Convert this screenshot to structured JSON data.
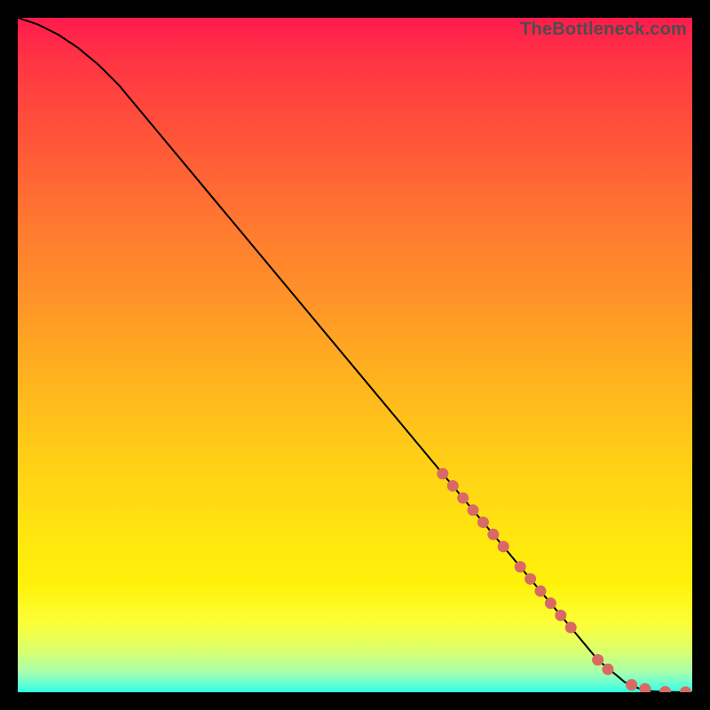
{
  "watermark": "TheBottleneck.com",
  "chart_data": {
    "type": "line",
    "title": "",
    "xlabel": "",
    "ylabel": "",
    "xlim": [
      0,
      100
    ],
    "ylim": [
      0,
      100
    ],
    "grid": false,
    "legend": false,
    "series": [
      {
        "name": "curve",
        "style": "line",
        "color": "#000000",
        "x": [
          0,
          3,
          6,
          9,
          12,
          15,
          20,
          30,
          40,
          50,
          60,
          70,
          80,
          86,
          90,
          92,
          94,
          96,
          98,
          100
        ],
        "y": [
          100,
          99,
          97.5,
          95.5,
          93,
          90,
          84,
          72,
          60,
          48,
          36,
          24,
          12,
          4.8,
          1.5,
          0.6,
          0.15,
          0.05,
          0.02,
          0.02
        ]
      },
      {
        "name": "highlight-points",
        "style": "marker",
        "color": "#d86a63",
        "x": [
          63,
          64.5,
          66,
          67.5,
          69,
          70.5,
          72,
          74.5,
          76,
          77.5,
          79,
          80.5,
          82,
          86,
          87.5,
          91,
          93,
          96,
          99
        ],
        "y": [
          32.4,
          30.6,
          28.8,
          27.0,
          25.2,
          23.4,
          21.6,
          18.6,
          16.8,
          15.0,
          13.2,
          11.4,
          9.6,
          4.8,
          3.4,
          1.1,
          0.5,
          0.07,
          0.02
        ]
      }
    ]
  }
}
